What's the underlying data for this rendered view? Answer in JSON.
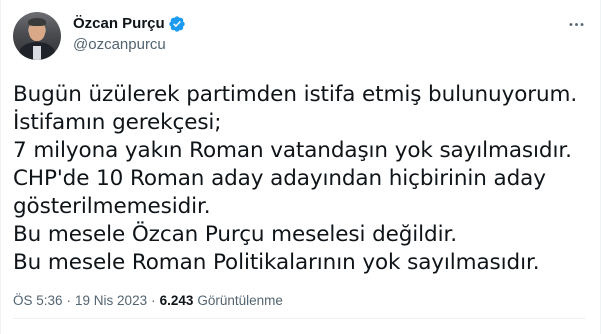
{
  "author": {
    "display_name": "Özcan Purçu",
    "handle": "@ozcanpurcu",
    "verified": true,
    "verified_color": "#1d9bf0",
    "avatar_icon": "profile-photo"
  },
  "menu": {
    "icon": "more-horizontal-icon"
  },
  "tweet": {
    "lines": [
      "Bugün üzülerek partimden istifa etmiş bulunuyorum.",
      "İstifamın gerekçesi;",
      "7 milyona yakın Roman vatandaşın yok sayılmasıdır.",
      "CHP'de 10 Roman aday adayından hiçbirinin aday",
      "gösterilmemesidir.",
      "Bu mesele Özcan Purçu meselesi değildir.",
      "Bu mesele Roman Politikalarının yok sayılmasıdır."
    ]
  },
  "meta": {
    "time": "ÖS 5:36",
    "separator": "·",
    "date": "19 Nis 2023",
    "views_count": "6.243",
    "views_label": "Görüntülenme"
  },
  "colors": {
    "text": "#0f1419",
    "secondary": "#536471",
    "border": "#eff3f4"
  }
}
